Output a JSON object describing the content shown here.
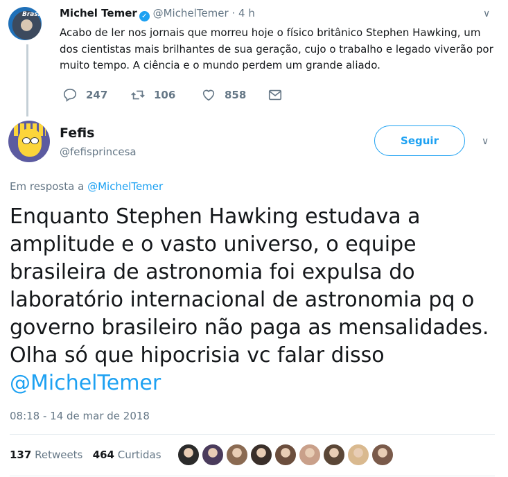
{
  "parent_tweet": {
    "author_name": "Michel Temer",
    "handle": "@MichelTemer",
    "separator": "·",
    "time": "4 h",
    "text": "Acabo de ler nos jornais que morreu hoje o físico britânico Stephen Hawking, um dos cientistas mais brilhantes de sua geração, cujo o trabalho e legado viverão por muito tempo. A ciência e o mundo perdem um grande aliado.",
    "avatar_text": "Brasil",
    "actions": {
      "reply_count": "247",
      "retweet_count": "106",
      "like_count": "858"
    }
  },
  "main_tweet": {
    "author_name": "Fefis",
    "handle": "@fefisprincesa",
    "follow_label": "Seguir",
    "reply_prefix": "Em resposta a",
    "reply_to": "@MichelTemer",
    "text": "Enquanto Stephen Hawking estudava a amplitude e o vasto universo, o equipe brasileira de astronomia foi expulsa do laboratório internacional de astronomia pq o governo brasileiro não paga as mensalidades. Olha só que hipocrisia vc falar disso",
    "mention": "@MichelTemer",
    "timestamp": "08:18 - 14 de mar de 2018",
    "retweets_count": "137",
    "retweets_label": "Retweets",
    "likes_count": "464",
    "likes_label": "Curtidas"
  },
  "colors": {
    "accent": "#1da1f2",
    "muted": "#657786",
    "text": "#14171a",
    "divider": "#e6ecf0"
  },
  "liker_avatars": [
    {
      "color": "#2b2b2b"
    },
    {
      "color": "#4a3b5c"
    },
    {
      "color": "#8a6a52"
    },
    {
      "color": "#3a2f2a"
    },
    {
      "color": "#6b4e3d"
    },
    {
      "color": "#c9a08a"
    },
    {
      "color": "#5a4636"
    },
    {
      "color": "#d9b98f"
    },
    {
      "color": "#7a5a4a"
    }
  ]
}
